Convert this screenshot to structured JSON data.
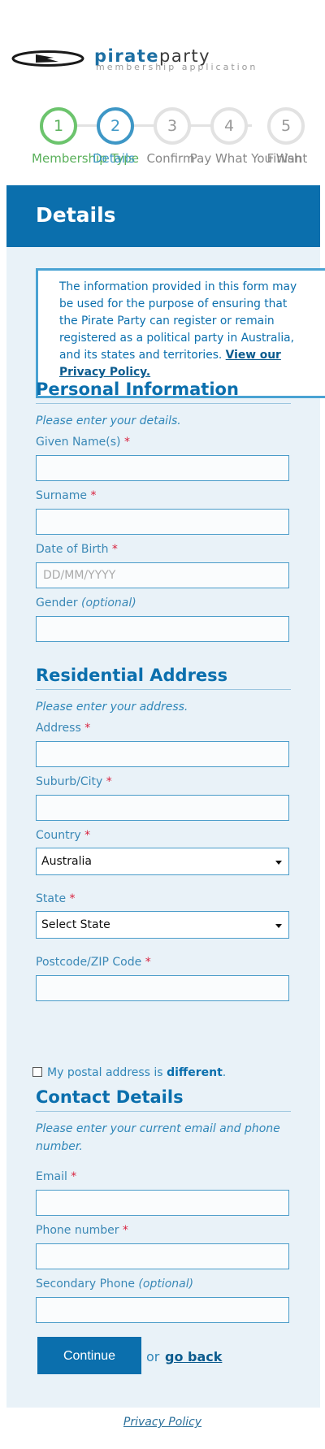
{
  "logo": {
    "word_part1": "pirate",
    "word_part2": "party",
    "tagline": "membership application"
  },
  "steps": [
    {
      "number": "1",
      "label": "Membership Type",
      "state": "done"
    },
    {
      "number": "2",
      "label": "Details",
      "state": "active"
    },
    {
      "number": "3",
      "label": "Confirm",
      "state": "pending"
    },
    {
      "number": "4",
      "label": "Pay What You Want",
      "state": "pending"
    },
    {
      "number": "5",
      "label": "Finish",
      "state": "pending"
    }
  ],
  "header": {
    "title": "Details"
  },
  "notice": {
    "text": "The information provided in this form may be used for the purpose of ensuring that the Pirate Party can register or remain registered as a political party in Australia, and its states and territories. ",
    "link": "View our Privacy Policy."
  },
  "personal": {
    "title": "Personal Information",
    "subtitle": "Please enter your details.",
    "given_name_label": "Given Name(s)",
    "surname_label": "Surname",
    "dob_label": "Date of Birth",
    "dob_placeholder": "DD/MM/YYYY",
    "gender_label": "Gender",
    "optional": "(optional)",
    "required_mark": "*"
  },
  "address": {
    "title": "Residential Address",
    "subtitle": "Please enter your address.",
    "address_label": "Address",
    "suburb_label": "Suburb/City",
    "country_label": "Country",
    "country_value": "Australia",
    "state_label": "State",
    "state_value": "Select State",
    "postcode_label": "Postcode/ZIP Code",
    "postal_text": "My postal address is ",
    "postal_bold": "different",
    "postal_end": "."
  },
  "contact": {
    "title": "Contact Details",
    "subtitle": "Please enter your current email and phone number.",
    "email_label": "Email",
    "phone_label": "Phone number",
    "secondary_label": "Secondary Phone"
  },
  "actions": {
    "continue": "Continue",
    "or": "or",
    "go_back": "go back"
  },
  "footer": {
    "privacy": "Privacy Policy"
  },
  "colors": {
    "brand": "#0b6fad",
    "done": "#6cc46d",
    "active": "#3e97c6",
    "required": "#d8233f",
    "card_bg": "#e9f2f8"
  }
}
